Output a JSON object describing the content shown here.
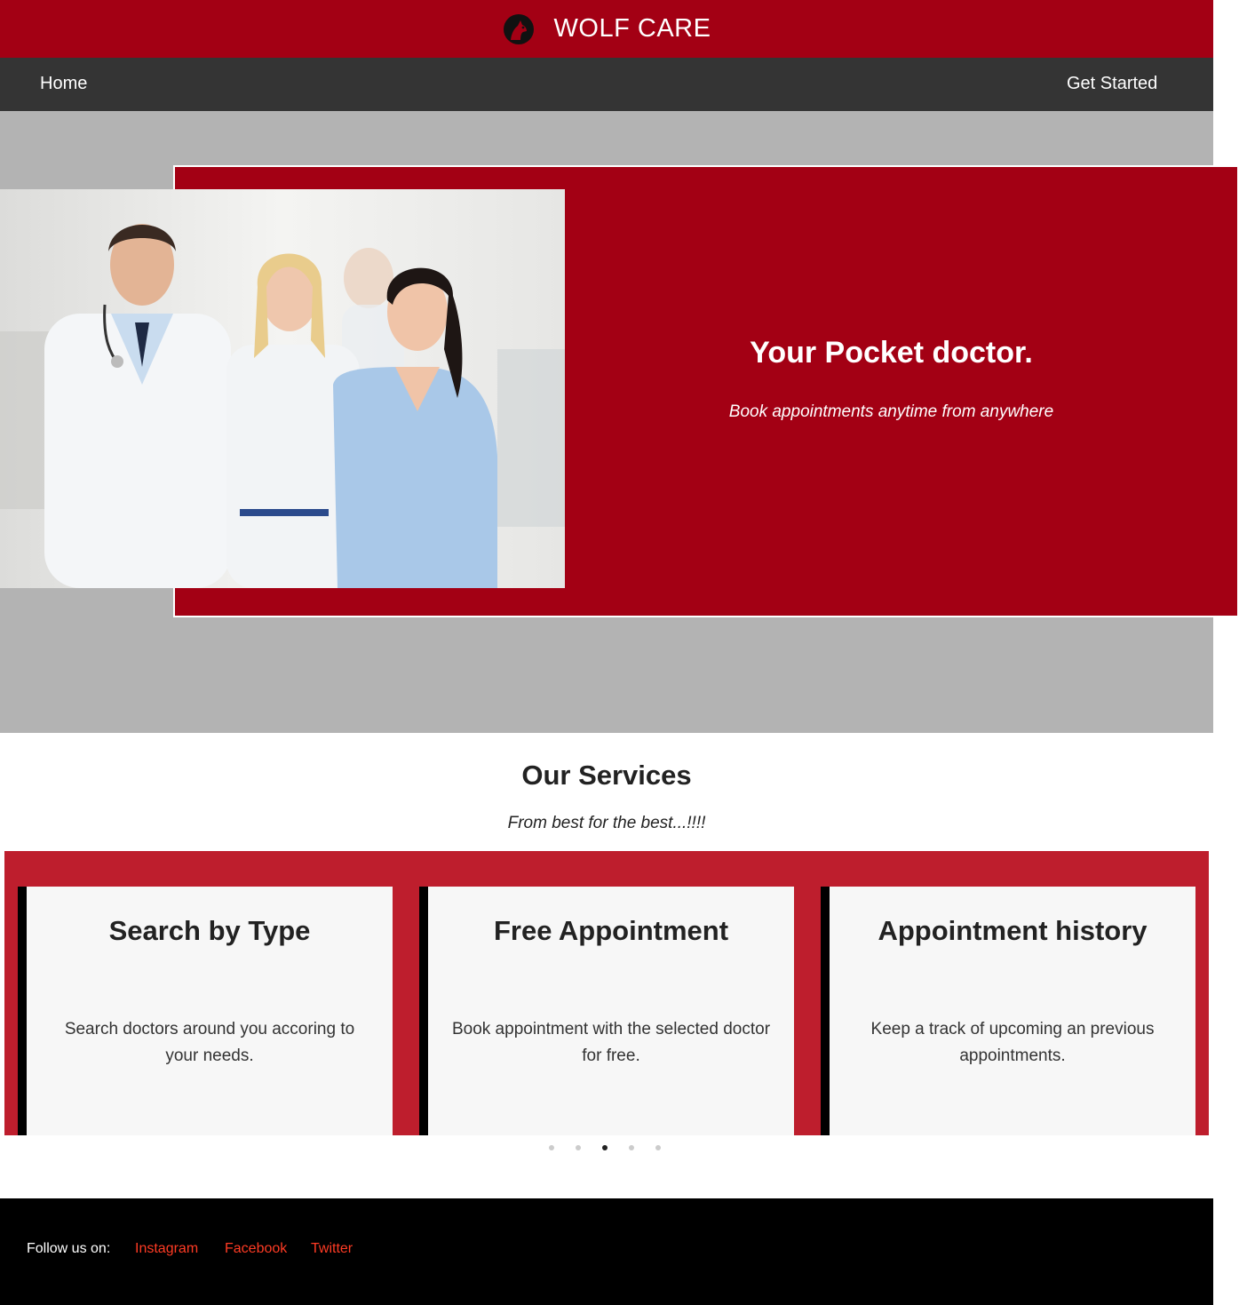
{
  "header": {
    "brand_name": "WOLF CARE",
    "logo_icon": "wolf-logo-icon",
    "background": "#a30014"
  },
  "nav": {
    "home_label": "Home",
    "get_started_label": "Get Started",
    "background": "#343434"
  },
  "hero": {
    "title": "Your Pocket doctor.",
    "subtitle": "Book appointments anytime from anywhere",
    "image": "medical-staff-photo",
    "card_color": "#a30014",
    "backdrop_color": "#b3b3b3"
  },
  "services": {
    "heading": "Our Services",
    "tagline": "From best for the best...!!!!",
    "band_color": "#be1e2d",
    "cards": [
      {
        "title": "Search by Type",
        "text": "Search doctors around you accoring to your needs."
      },
      {
        "title": "Free Appointment",
        "text": "Book appointment with the selected doctor for free."
      },
      {
        "title": "Appointment history",
        "text": "Keep a track of upcoming an previous appointments."
      }
    ],
    "carousel": {
      "slide_count": 5,
      "active_index": 2
    }
  },
  "footer": {
    "follow_label": "Follow us on:",
    "links": [
      "Instagram",
      "Facebook",
      "Twitter"
    ],
    "link_color": "#ff3b24"
  }
}
